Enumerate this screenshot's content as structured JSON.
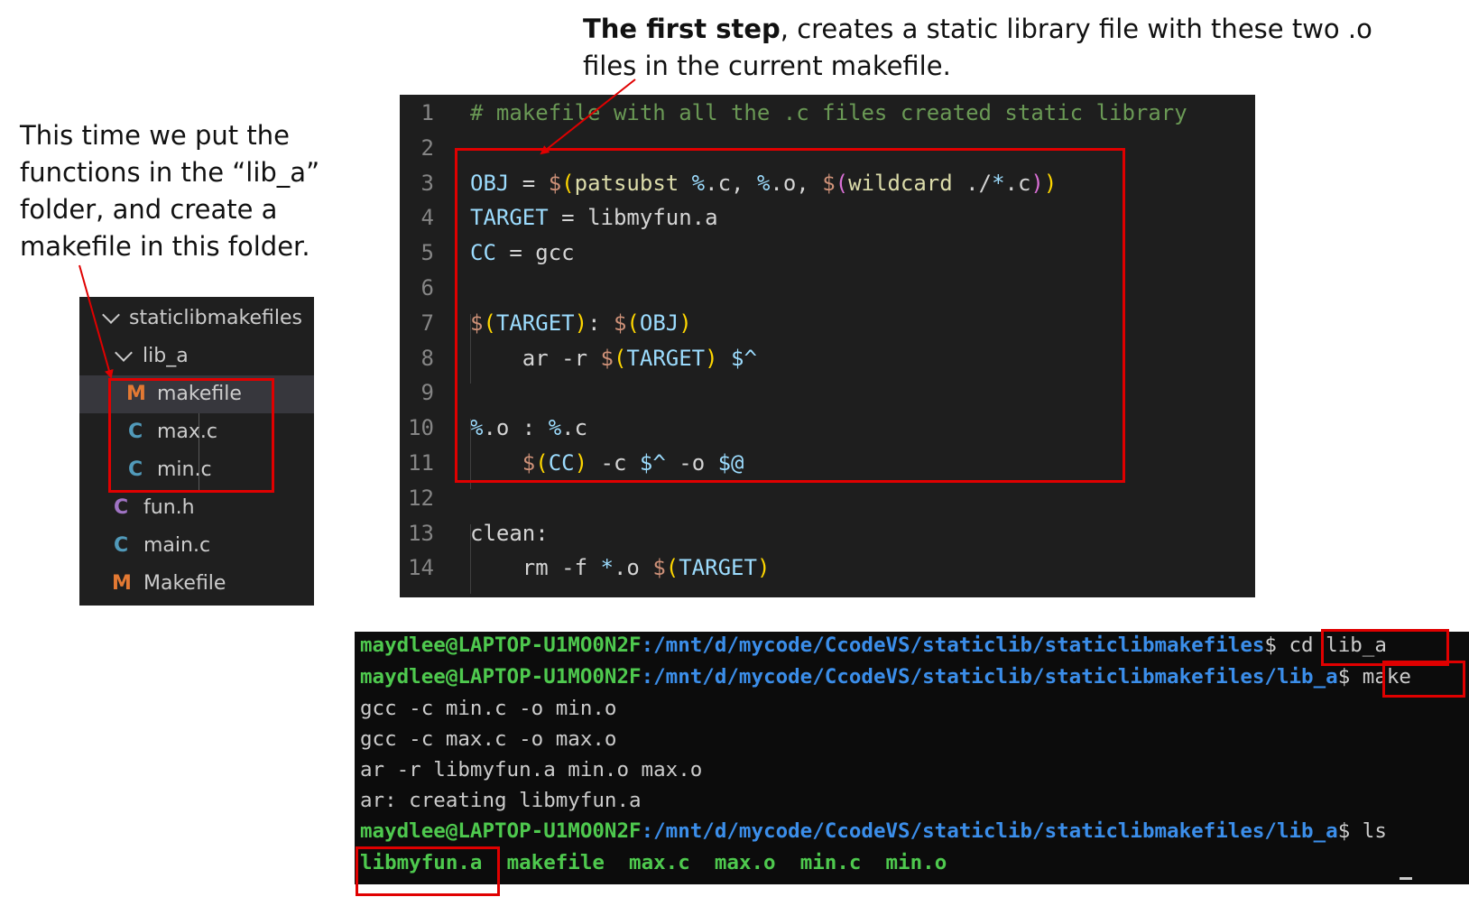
{
  "annotations": {
    "top_bold": "The first step",
    "top_rest": ", creates a static library file with these two .o files in the current makefile.",
    "left": "This time we put the functions in the “lib_a” folder, and create a makefile in this folder."
  },
  "explorer": {
    "root_folder": "staticlibmakefiles",
    "sub_folder": "lib_a",
    "items": [
      {
        "icon": "M",
        "label": "makefile",
        "type": "makefile"
      },
      {
        "icon": "C",
        "label": "max.c",
        "type": "c"
      },
      {
        "icon": "C",
        "label": "min.c",
        "type": "c"
      },
      {
        "icon": "C",
        "label": "fun.h",
        "type": "h"
      },
      {
        "icon": "C",
        "label": "main.c",
        "type": "c"
      },
      {
        "icon": "M",
        "label": "Makefile",
        "type": "makefile"
      }
    ]
  },
  "editor": {
    "line_numbers": [
      "1",
      "2",
      "3",
      "4",
      "5",
      "6",
      "7",
      "8",
      "9",
      "10",
      "11",
      "12",
      "13",
      "14"
    ],
    "lines": [
      "# makefile with all the .c files created static library",
      "",
      "OBJ = $(patsubst %.c, %.o, $(wildcard ./*.c))",
      "TARGET = libmyfun.a",
      "CC = gcc",
      "",
      "$(TARGET): $(OBJ)",
      "    ar -r $(TARGET) $^",
      "",
      "%.o : %.c",
      "    $(CC) -c $^ -o $@",
      "",
      "clean:",
      "    rm -f *.o $(TARGET)"
    ]
  },
  "terminal": {
    "prompt_user": "maydlee@LAPTOP-U1MO0N2F",
    "path_1": ":/mnt/d/mycode/CcodeVS/staticlib/staticlibmakefiles",
    "cmd_1": "cd lib_a",
    "path_2": ":/mnt/d/mycode/CcodeVS/staticlib/staticlibmakefiles/lib_a",
    "cmd_2": "make",
    "output": [
      "gcc -c min.c -o min.o",
      "gcc -c max.c -o max.o",
      "ar -r libmyfun.a min.o max.o",
      "ar: creating libmyfun.a"
    ],
    "cmd_3": "ls",
    "ls_files": [
      "libmyfun.a",
      "makefile",
      "max.c",
      "max.o",
      "min.c",
      "min.o"
    ]
  },
  "colors": {
    "highlight": "#e00000",
    "terminal_green": "#4ec94e",
    "terminal_blue": "#3b8eea"
  }
}
